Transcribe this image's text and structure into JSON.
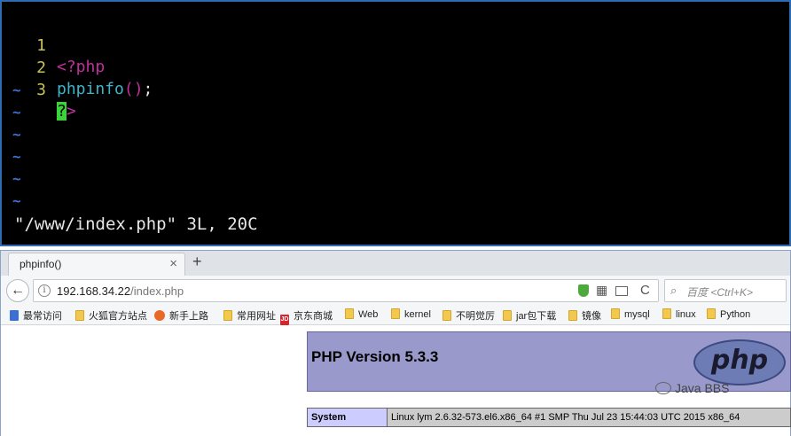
{
  "terminal": {
    "lines": [
      {
        "number": "1",
        "tag_open": "<?php"
      },
      {
        "number": "2",
        "function": "phpinfo",
        "paren": "()",
        "semicolon": ";"
      },
      {
        "number": "3",
        "cursor_char": "?",
        "rest": ">"
      }
    ],
    "tilde": "~",
    "status": "\"/www/index.php\" 3L, 20C"
  },
  "browser": {
    "tab_title": "phpinfo()",
    "tab_close": "×",
    "new_tab": "+",
    "back": "←",
    "info": "i",
    "url_host": "192.168.34.22",
    "url_path": "/index.php",
    "reload": "C",
    "search_placeholder": "百度 <Ctrl+K>",
    "bookmarks": [
      {
        "label": "最常访问",
        "icon": "blue"
      },
      {
        "label": "火狐官方站点",
        "icon": "folder"
      },
      {
        "label": "新手上路",
        "icon": "firefox"
      },
      {
        "label": "常用网址",
        "icon": "folder"
      },
      {
        "label": "京东商城",
        "icon": "jd"
      },
      {
        "label": "Web",
        "icon": "folder"
      },
      {
        "label": "kernel",
        "icon": "folder"
      },
      {
        "label": "不明觉厉",
        "icon": "folder"
      },
      {
        "label": "jar包下载",
        "icon": "folder"
      },
      {
        "label": "镜像",
        "icon": "folder"
      },
      {
        "label": "mysql",
        "icon": "folder"
      },
      {
        "label": "linux",
        "icon": "folder"
      },
      {
        "label": "Python",
        "icon": "folder"
      }
    ]
  },
  "page": {
    "php_version": "PHP Version 5.3.3",
    "logo_text": "php",
    "system_label": "System",
    "system_value": "Linux lym 2.6.32-573.el6.x86_64 #1 SMP Thu Jul 23 15:44:03 UTC 2015 x86_64"
  },
  "watermark": "Java BBS",
  "colors": {
    "terminal_bg": "#000000",
    "php_header": "#9999cc",
    "table_label": "#ccccff",
    "table_value": "#cccccc"
  }
}
